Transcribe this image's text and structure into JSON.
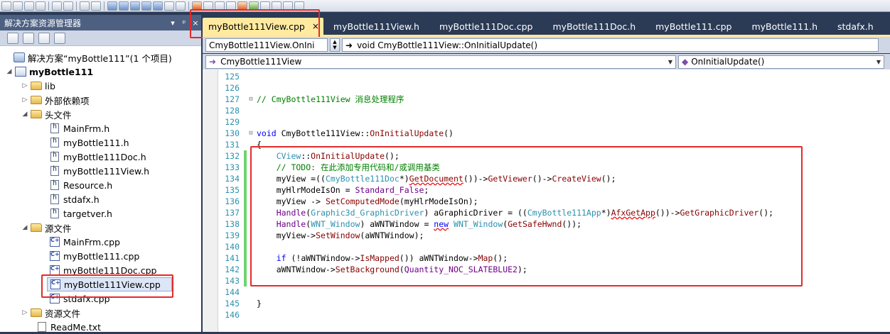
{
  "solution_explorer": {
    "title": "解决方案资源管理器",
    "pin": "▼ ᵖ",
    "close": "×",
    "items": [
      {
        "label": "解决方案“myBottle111”(1 个项目)",
        "kind": "solution"
      },
      {
        "label": "myBottle111",
        "kind": "project"
      },
      {
        "label": "lib",
        "kind": "folder"
      },
      {
        "label": "外部依赖项",
        "kind": "folder"
      },
      {
        "label": "头文件",
        "kind": "folder"
      },
      {
        "label": "MainFrm.h",
        "kind": "header"
      },
      {
        "label": "myBottle111.h",
        "kind": "header"
      },
      {
        "label": "myBottle111Doc.h",
        "kind": "header"
      },
      {
        "label": "myBottle111View.h",
        "kind": "header"
      },
      {
        "label": "Resource.h",
        "kind": "header"
      },
      {
        "label": "stdafx.h",
        "kind": "header"
      },
      {
        "label": "targetver.h",
        "kind": "header"
      },
      {
        "label": "源文件",
        "kind": "folder"
      },
      {
        "label": "MainFrm.cpp",
        "kind": "cpp"
      },
      {
        "label": "myBottle111.cpp",
        "kind": "cpp"
      },
      {
        "label": "myBottle111Doc.cpp",
        "kind": "cpp"
      },
      {
        "label": "myBottle111View.cpp",
        "kind": "cpp"
      },
      {
        "label": "stdafx.cpp",
        "kind": "cpp"
      },
      {
        "label": "资源文件",
        "kind": "folder"
      },
      {
        "label": "ReadMe.txt",
        "kind": "text"
      }
    ]
  },
  "tabs": [
    {
      "label": "myBottle111View.cpp",
      "active": true
    },
    {
      "label": "myBottle111View.h"
    },
    {
      "label": "myBottle111Doc.cpp"
    },
    {
      "label": "myBottle111Doc.h"
    },
    {
      "label": "myBottle111.cpp"
    },
    {
      "label": "myBottle111.h"
    },
    {
      "label": "stdafx.h"
    }
  ],
  "tab_close": "×",
  "nav": {
    "scope": "CmyBottle111View.OnIni",
    "signature": "void CmyBottle111View::OnInitialUpdate()",
    "class_dd": "CmyBottle111View",
    "member_dd": "OnInitialUpdate()"
  },
  "code": {
    "line_numbers": [
      "125",
      "126",
      "127",
      "128",
      "129",
      "130",
      "131",
      "132",
      "133",
      "134",
      "135",
      "136",
      "137",
      "138",
      "139",
      "140",
      "141",
      "142",
      "143",
      "144",
      "145",
      "146"
    ],
    "l127": "// CmyBottle111View 消息处理程序",
    "l130a": "void",
    "l130b": " CmyBottle111View::",
    "l130c": "OnInitialUpdate",
    "l130d": "()",
    "l131": "{",
    "l132a": "    CView",
    "l132b": "::",
    "l132c": "OnInitialUpdate",
    "l132d": "();",
    "l133": "    // TODO: 在此添加专用代码和/或调用基类",
    "l134a": "    myView",
    "l134b": " =((",
    "l134c": "CmyBottle111Doc",
    "l134d": "*)",
    "l134e": "GetDocument",
    "l134f": "())->",
    "l134g": "GetViewer",
    "l134h": "()->",
    "l134i": "CreateView",
    "l134j": "();",
    "l135a": "    myHlrModeIsOn",
    "l135b": " = ",
    "l135c": "Standard_False",
    "l135d": ";",
    "l136a": "    myView",
    "l136b": " -> ",
    "l136c": "SetComputedMode",
    "l136d": "(myHlrModeIsOn);",
    "l137a": "    Handle",
    "l137b": "(",
    "l137c": "Graphic3d_GraphicDriver",
    "l137d": ") aGraphicDriver = ((",
    "l137e": "CmyBottle111App",
    "l137f": "*)",
    "l137g": "AfxGetApp",
    "l137h": "())->",
    "l137i": "GetGraphicDriver",
    "l137j": "();",
    "l138a": "    Handle",
    "l138b": "(",
    "l138c": "WNT_Window",
    "l138d": ") aWNTWindow = ",
    "l138e": "new",
    "l138f": " ",
    "l138g": "WNT_Window",
    "l138h": "(",
    "l138i": "GetSafeHwnd",
    "l138j": "());",
    "l139a": "    myView",
    "l139b": "->",
    "l139c": "SetWindow",
    "l139d": "(aWNTWindow);",
    "l141a": "    if",
    "l141b": " (!aWNTWindow->",
    "l141c": "IsMapped",
    "l141d": "()) aWNTWindow->",
    "l141e": "Map",
    "l141f": "();",
    "l142a": "    aWNTWindow->",
    "l142b": "SetBackground",
    "l142c": "(",
    "l142d": "Quantity_NOC_SLATEBLUE2",
    "l142e": ");",
    "l145": "}"
  }
}
